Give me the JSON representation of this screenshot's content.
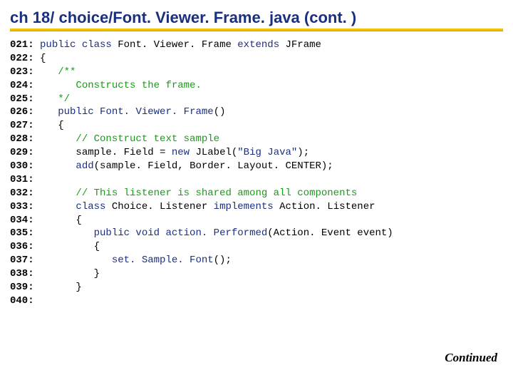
{
  "title": "ch 18/ choice/Font. Viewer. Frame. java  (cont. )",
  "footer": "Continued",
  "lines": [
    {
      "num": "021:",
      "spans": [
        {
          "cls": "pd",
          "text": " "
        },
        {
          "cls": "kw",
          "text": "public class"
        },
        {
          "cls": "pd",
          "text": " Font. Viewer. Frame "
        },
        {
          "cls": "kw",
          "text": "extends"
        },
        {
          "cls": "pd",
          "text": " JFrame"
        }
      ]
    },
    {
      "num": "022:",
      "spans": [
        {
          "cls": "pd",
          "text": " {"
        }
      ]
    },
    {
      "num": "023:",
      "spans": [
        {
          "cls": "pd",
          "text": "    "
        },
        {
          "cls": "cm",
          "text": "/**"
        }
      ]
    },
    {
      "num": "024:",
      "spans": [
        {
          "cls": "pd",
          "text": "       "
        },
        {
          "cls": "cm",
          "text": "Constructs the frame."
        }
      ]
    },
    {
      "num": "025:",
      "spans": [
        {
          "cls": "pd",
          "text": "    "
        },
        {
          "cls": "cm",
          "text": "*/"
        }
      ]
    },
    {
      "num": "026:",
      "spans": [
        {
          "cls": "pd",
          "text": "    "
        },
        {
          "cls": "kw",
          "text": "public"
        },
        {
          "cls": "pd",
          "text": " "
        },
        {
          "cls": "id",
          "text": "Font. Viewer. Frame"
        },
        {
          "cls": "pn",
          "text": "()"
        }
      ]
    },
    {
      "num": "027:",
      "spans": [
        {
          "cls": "pd",
          "text": "    {"
        }
      ]
    },
    {
      "num": "028:",
      "spans": [
        {
          "cls": "pd",
          "text": "       "
        },
        {
          "cls": "cm",
          "text": "// Construct text sample"
        }
      ]
    },
    {
      "num": "029:",
      "spans": [
        {
          "cls": "pd",
          "text": "       sample. Field = "
        },
        {
          "cls": "kw",
          "text": "new"
        },
        {
          "cls": "pd",
          "text": " JLabel("
        },
        {
          "cls": "str",
          "text": "\"Big Java\""
        },
        {
          "cls": "pd",
          "text": ");"
        }
      ]
    },
    {
      "num": "030:",
      "spans": [
        {
          "cls": "pd",
          "text": "       "
        },
        {
          "cls": "id",
          "text": "add"
        },
        {
          "cls": "pd",
          "text": "(sample. Field, Border. Layout. CENTER);"
        }
      ]
    },
    {
      "num": "031:",
      "spans": [
        {
          "cls": "pd",
          "text": " "
        }
      ]
    },
    {
      "num": "032:",
      "spans": [
        {
          "cls": "pd",
          "text": "       "
        },
        {
          "cls": "cm",
          "text": "// This listener is shared among all components"
        }
      ]
    },
    {
      "num": "033:",
      "spans": [
        {
          "cls": "pd",
          "text": "       "
        },
        {
          "cls": "kw",
          "text": "class"
        },
        {
          "cls": "pd",
          "text": " Choice. Listener "
        },
        {
          "cls": "kw",
          "text": "implements"
        },
        {
          "cls": "pd",
          "text": " Action. Listener"
        }
      ]
    },
    {
      "num": "034:",
      "spans": [
        {
          "cls": "pd",
          "text": "       {"
        }
      ]
    },
    {
      "num": "035:",
      "spans": [
        {
          "cls": "pd",
          "text": "          "
        },
        {
          "cls": "kw",
          "text": "public void"
        },
        {
          "cls": "pd",
          "text": " "
        },
        {
          "cls": "id",
          "text": "action. Performed"
        },
        {
          "cls": "pd",
          "text": "(Action. Event event)"
        }
      ]
    },
    {
      "num": "036:",
      "spans": [
        {
          "cls": "pd",
          "text": "          {"
        }
      ]
    },
    {
      "num": "037:",
      "spans": [
        {
          "cls": "pd",
          "text": "             "
        },
        {
          "cls": "id",
          "text": "set. Sample. Font"
        },
        {
          "cls": "pd",
          "text": "();"
        }
      ]
    },
    {
      "num": "038:",
      "spans": [
        {
          "cls": "pd",
          "text": "          }"
        }
      ]
    },
    {
      "num": "039:",
      "spans": [
        {
          "cls": "pd",
          "text": "       }"
        }
      ]
    },
    {
      "num": "040:",
      "spans": [
        {
          "cls": "pd",
          "text": " "
        }
      ]
    }
  ]
}
